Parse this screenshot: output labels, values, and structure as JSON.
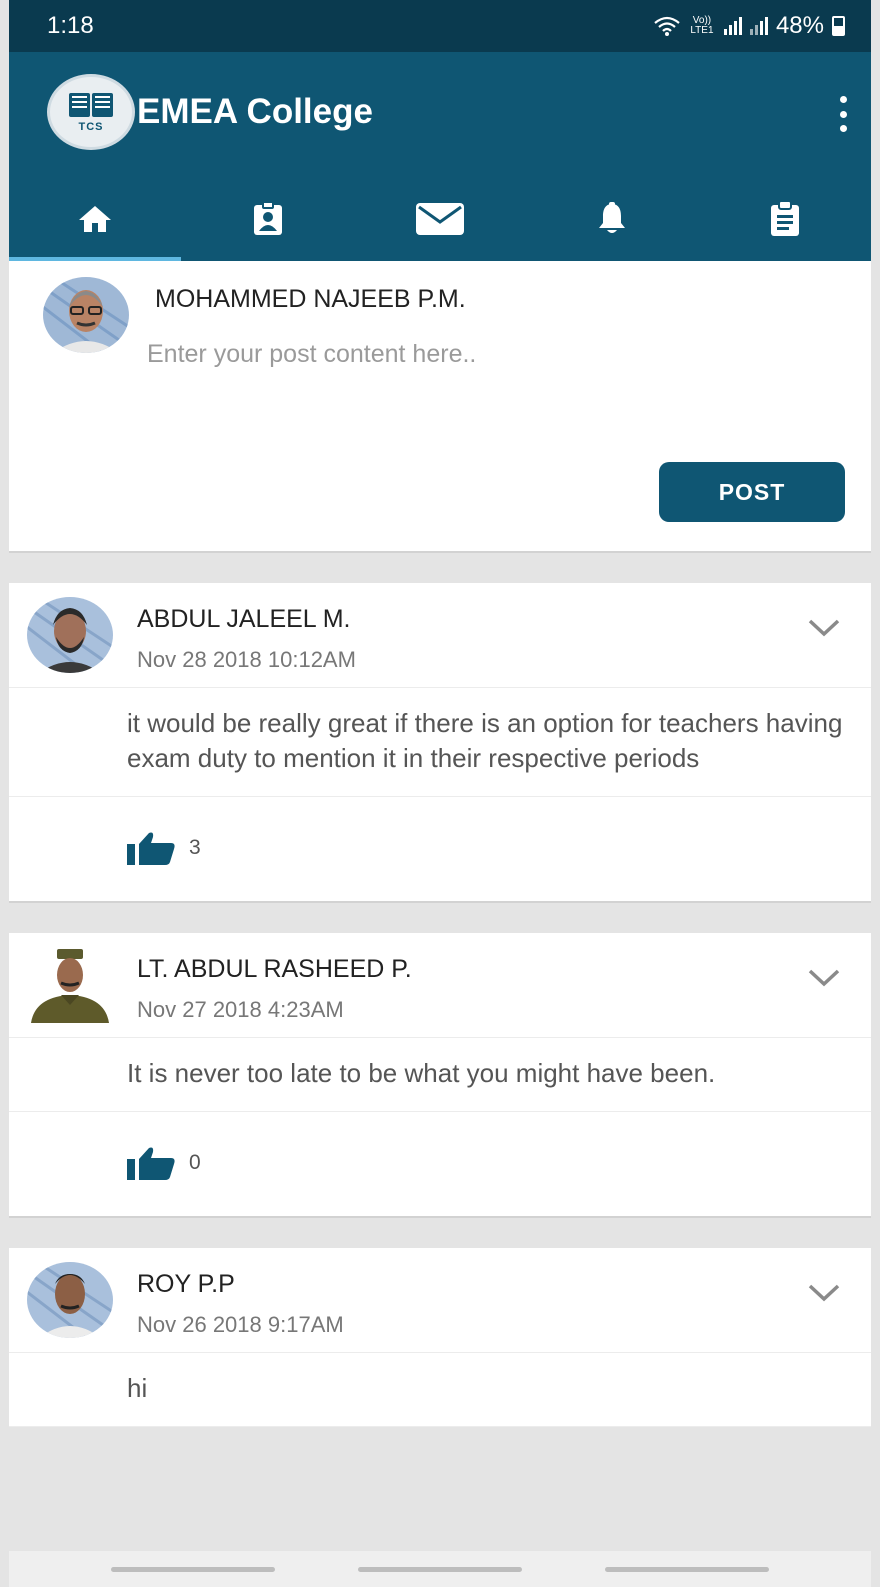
{
  "status_bar": {
    "time": "1:18",
    "lte": "Vo)) LTE1",
    "battery": "48%"
  },
  "app_bar": {
    "title": "EMEA College",
    "logo_text": "TCS"
  },
  "tabs": [
    {
      "icon": "home-icon",
      "active": true
    },
    {
      "icon": "id-badge-icon",
      "active": false
    },
    {
      "icon": "mail-icon",
      "active": false
    },
    {
      "icon": "bell-icon",
      "active": false
    },
    {
      "icon": "clipboard-icon",
      "active": false
    }
  ],
  "composer": {
    "user_name": "MOHAMMED NAJEEB P.M.",
    "placeholder": "Enter your post content here..",
    "post_label": "POST"
  },
  "posts": [
    {
      "author": "ABDUL JALEEL M.",
      "timestamp": "Nov 28 2018 10:12AM",
      "content": "it would be really great if there is an option for teachers having exam duty to mention it in their respective periods",
      "likes": "3"
    },
    {
      "author": "LT. ABDUL RASHEED P.",
      "timestamp": "Nov 27 2018  4:23AM",
      "content": "It is never too late to be what you might have been.",
      "likes": "0"
    },
    {
      "author": "ROY P.P",
      "timestamp": "Nov 26 2018  9:17AM",
      "content": "hi",
      "likes": ""
    }
  ],
  "colors": {
    "primary": "#0f5673",
    "status_bar": "#0a3a4f",
    "tab_indicator": "#5fb7e0"
  }
}
